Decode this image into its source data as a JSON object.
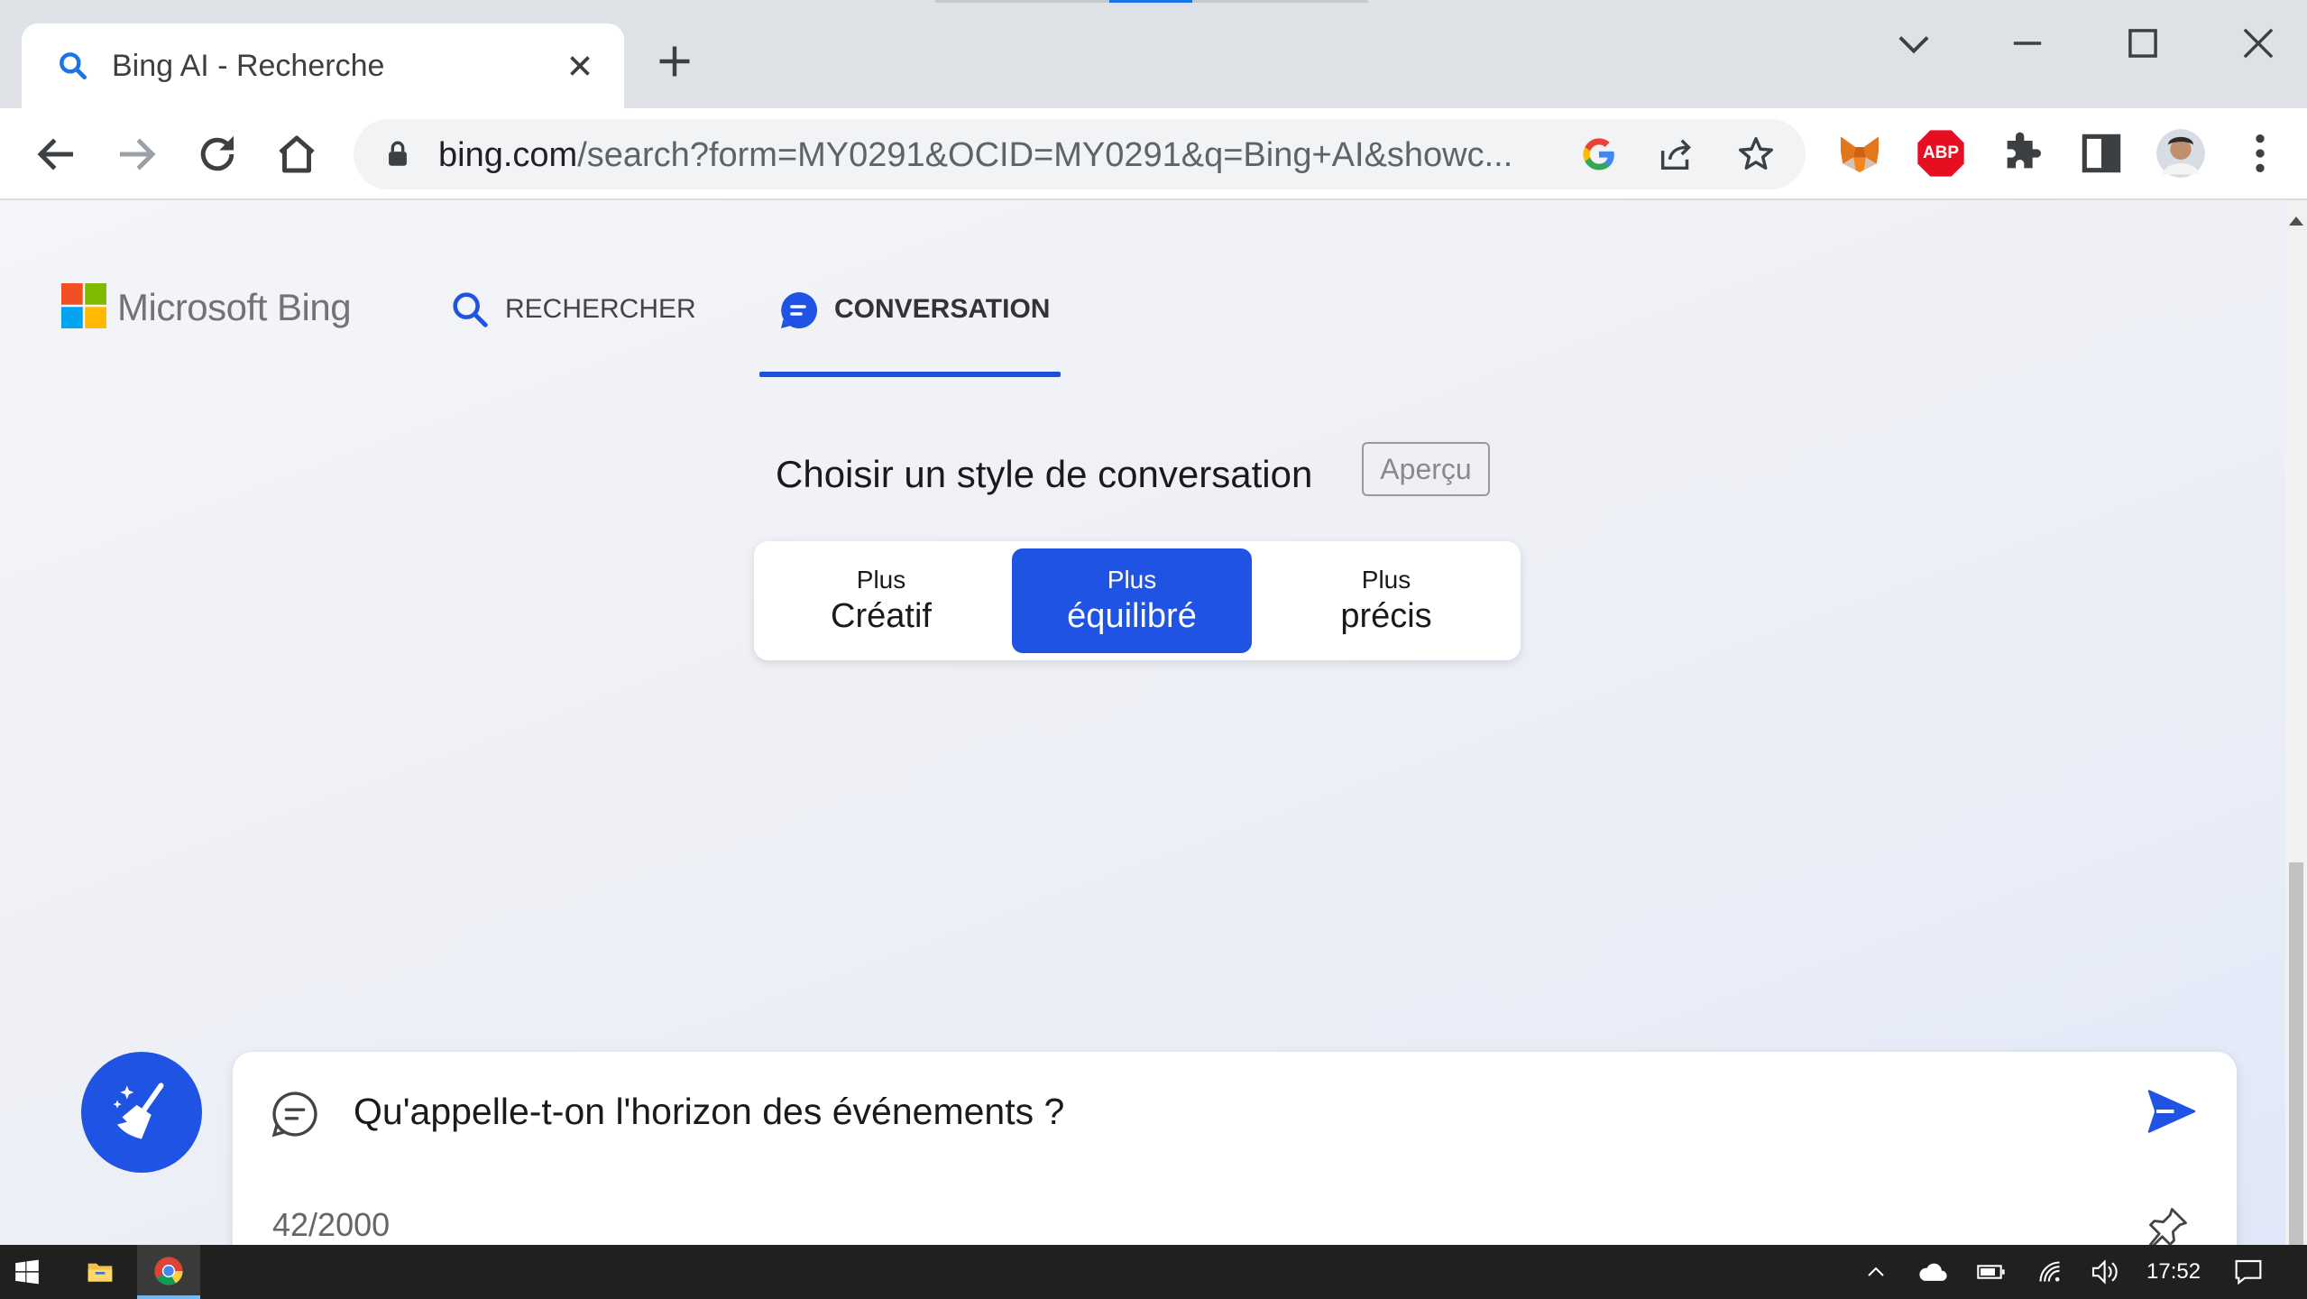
{
  "browser": {
    "tab_title": "Bing AI - Recherche",
    "url_domain": "bing.com",
    "url_path": "/search?form=MY0291&OCID=MY0291&q=Bing+AI&showc...",
    "extension_abp_label": "ABP"
  },
  "bing": {
    "logo_text": "Microsoft Bing",
    "nav": {
      "search_label": "RECHERCHER",
      "chat_label": "CONVERSATION"
    },
    "style_heading": "Choisir un style de conversation",
    "preview_badge": "Aperçu",
    "styles": [
      {
        "line1": "Plus",
        "line2": "Créatif",
        "active": false
      },
      {
        "line1": "Plus",
        "line2": "équilibré",
        "active": true
      },
      {
        "line1": "Plus",
        "line2": "précis",
        "active": false
      }
    ],
    "input": {
      "query": "Qu'appelle-t-on l'horizon des événements ?",
      "counter": "42/2000"
    },
    "accent_color": "#1f53e3"
  },
  "taskbar": {
    "clock": "17:52"
  }
}
